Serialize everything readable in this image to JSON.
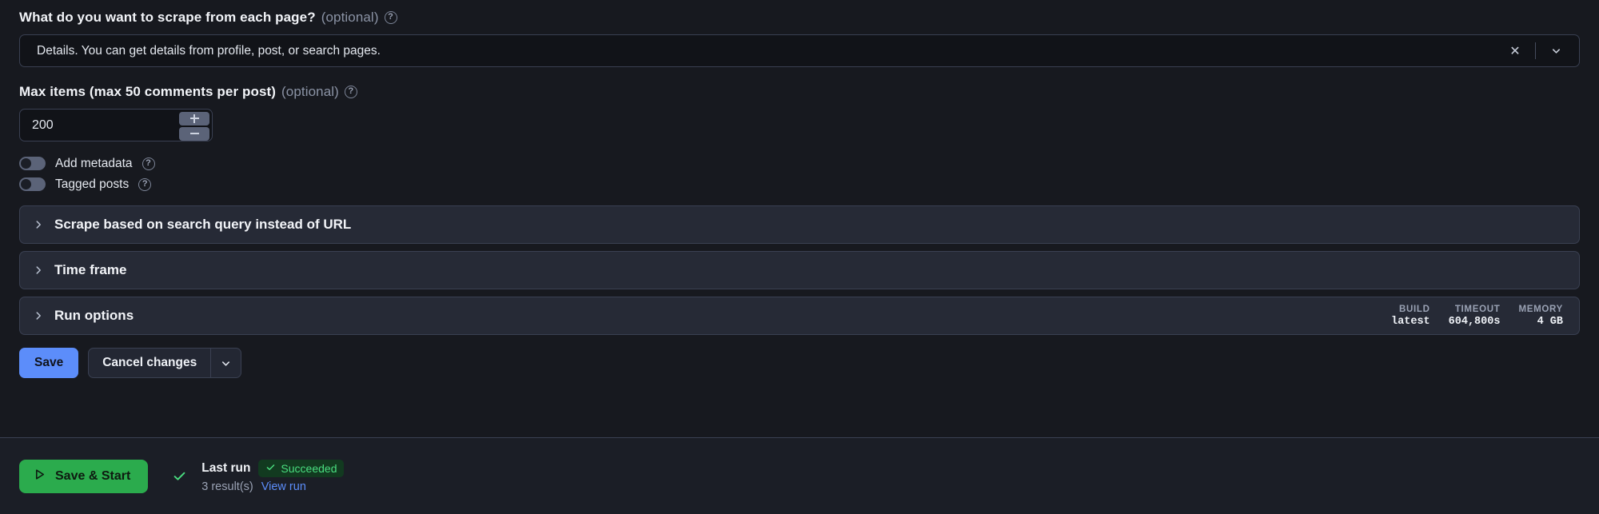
{
  "scrape_field": {
    "label": "What do you want to scrape from each page?",
    "optional": "(optional)",
    "value": "Details. You can get details from profile, post, or search pages."
  },
  "max_items_field": {
    "label": "Max items (max 50 comments per post)",
    "optional": "(optional)",
    "value": "200"
  },
  "toggles": [
    {
      "label": "Add metadata"
    },
    {
      "label": "Tagged posts"
    }
  ],
  "accordions": [
    {
      "title": "Scrape based on search query instead of URL"
    },
    {
      "title": "Time frame"
    },
    {
      "title": "Run options"
    }
  ],
  "run_meta": [
    {
      "label": "BUILD",
      "value": "latest"
    },
    {
      "label": "TIMEOUT",
      "value": "604,800s"
    },
    {
      "label": "MEMORY",
      "value": "4 GB"
    }
  ],
  "actions": {
    "save": "Save",
    "cancel": "Cancel changes"
  },
  "bottom": {
    "start_button": "Save & Start",
    "last_run_label": "Last run",
    "status": "Succeeded",
    "results": "3 result(s)",
    "view_run": "View run"
  },
  "colors": {
    "accent_blue": "#5c8dfa",
    "success_green": "#2bab4d",
    "badge_green": "#4ade80",
    "page_bg": "#17191f",
    "panel_bg": "#262a36"
  }
}
